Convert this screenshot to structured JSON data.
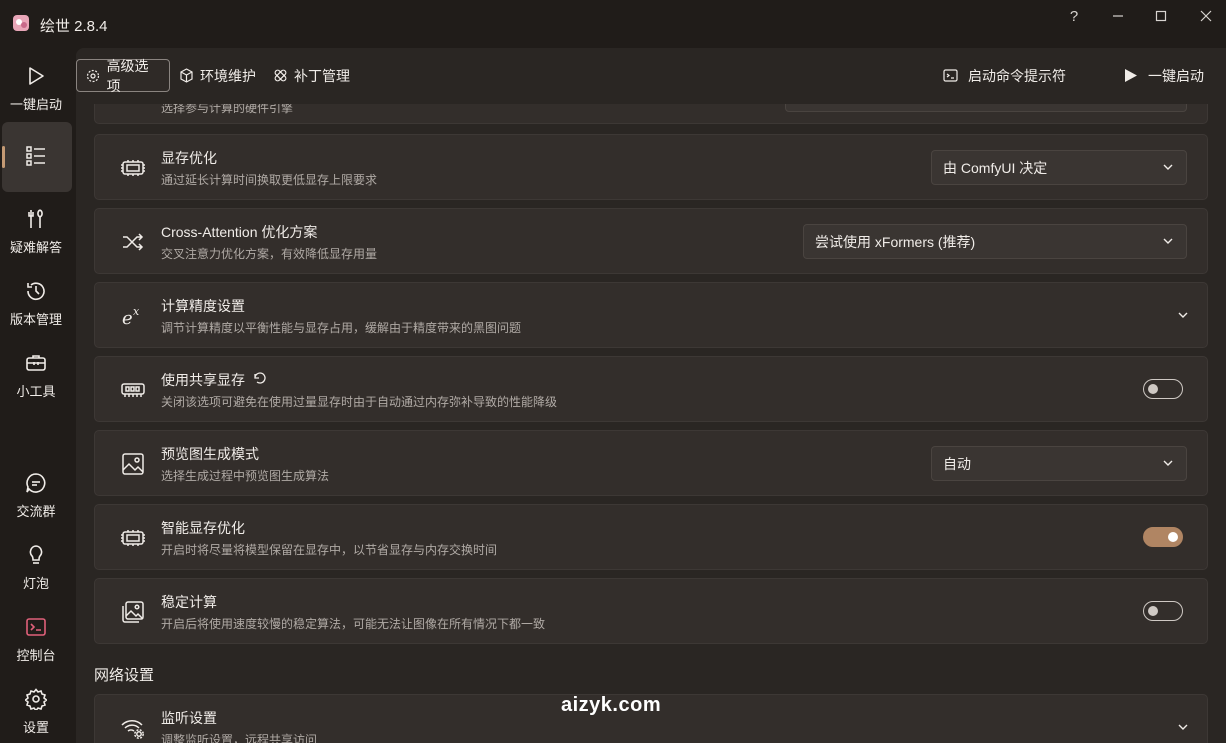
{
  "window": {
    "title": "绘世 2.8.4",
    "controls": {
      "help": "?",
      "minimize": "—",
      "maximize": "☐",
      "close": "✕"
    }
  },
  "sidebar": {
    "items": [
      {
        "label": "一键启动",
        "icon": "play-icon"
      },
      {
        "label": "",
        "icon": "list-settings-icon",
        "active": true
      },
      {
        "label": "疑难解答",
        "icon": "tools-icon"
      },
      {
        "label": "版本管理",
        "icon": "history-icon"
      },
      {
        "label": "小工具",
        "icon": "toolbox-icon"
      },
      {
        "label": "交流群",
        "icon": "chat-icon"
      },
      {
        "label": "灯泡",
        "icon": "bulb-icon"
      },
      {
        "label": "控制台",
        "icon": "console-icon"
      },
      {
        "label": "设置",
        "icon": "gear-icon"
      }
    ]
  },
  "toolbar": {
    "tabs": [
      {
        "label": "高级选项",
        "active": true
      },
      {
        "label": "环境维护"
      },
      {
        "label": "补丁管理"
      }
    ],
    "console_prompt": "启动命令提示符",
    "launch": "一键启动"
  },
  "settings": {
    "partial": {
      "desc": "选择参与计算的硬件引擎"
    },
    "vram_opt": {
      "title": "显存优化",
      "desc": "通过延长计算时间换取更低显存上限要求",
      "value": "由 ComfyUI 决定"
    },
    "cross_attn": {
      "title": "Cross-Attention 优化方案",
      "desc": "交叉注意力优化方案，有效降低显存用量",
      "value": "尝试使用 xFormers (推荐)"
    },
    "precision": {
      "title": "计算精度设置",
      "desc": "调节计算精度以平衡性能与显存占用，缓解由于精度带来的黑图问题"
    },
    "shared_vram": {
      "title": "使用共享显存",
      "desc": "关闭该选项可避免在使用过量显存时由于自动通过内存弥补导致的性能降级",
      "enabled": false
    },
    "preview_mode": {
      "title": "预览图生成模式",
      "desc": "选择生成过程中预览图生成算法",
      "value": "自动"
    },
    "smart_vram": {
      "title": "智能显存优化",
      "desc": "开启时将尽量将模型保留在显存中，以节省显存与内存交换时间",
      "enabled": true
    },
    "stable_calc": {
      "title": "稳定计算",
      "desc": "开启后将使用速度较慢的稳定算法，可能无法让图像在所有情况下都一致",
      "enabled": false
    }
  },
  "network": {
    "section_title": "网络设置",
    "listen": {
      "title": "监听设置",
      "desc": "调整监听设置，远程共享访问"
    }
  },
  "watermark": "aizyk.com",
  "colors": {
    "accent": "#b08563",
    "background": "#201c19",
    "panel": "#2a2623",
    "card": "#332e2b"
  }
}
